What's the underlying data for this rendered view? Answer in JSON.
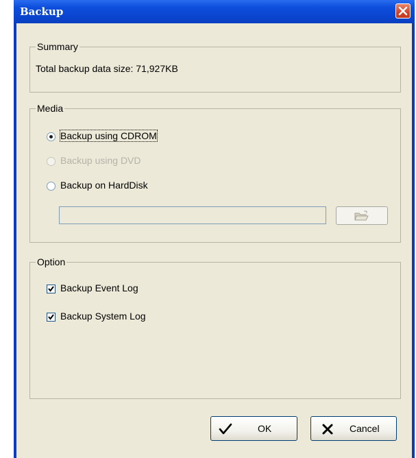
{
  "window": {
    "title": "Backup",
    "close_icon": "close-icon"
  },
  "summary": {
    "label": "Summary",
    "text": "Total backup data size: 71,927KB"
  },
  "media": {
    "label": "Media",
    "options": [
      {
        "label": "Backup using CDROM",
        "selected": true,
        "enabled": true
      },
      {
        "label": "Backup using DVD",
        "selected": false,
        "enabled": false
      },
      {
        "label": "Backup on HardDisk",
        "selected": false,
        "enabled": true
      }
    ],
    "path_value": "",
    "browse_icon": "folder-open-icon"
  },
  "option": {
    "label": "Option",
    "checkboxes": [
      {
        "label": "Backup Event Log",
        "checked": true
      },
      {
        "label": "Backup System Log",
        "checked": true
      }
    ]
  },
  "buttons": {
    "ok_label": "OK",
    "cancel_label": "Cancel",
    "ok_icon": "checkmark-icon",
    "cancel_icon": "x-mark-icon"
  },
  "colors": {
    "titlebar": "#0a45d0",
    "face": "#ece9d8",
    "close": "#d2452a"
  }
}
